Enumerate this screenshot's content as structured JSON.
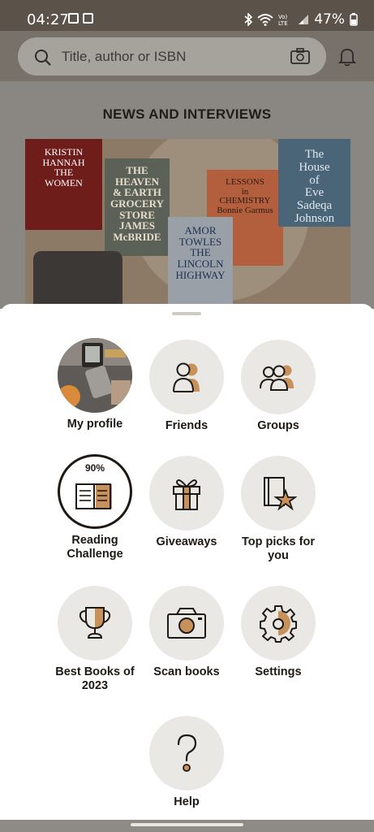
{
  "status_bar": {
    "time": "04:27",
    "battery": "47%",
    "icons": [
      "image-icon",
      "sim-icon",
      "bluetooth-icon",
      "wifi-icon",
      "volte-icon",
      "signal-icon",
      "battery-icon"
    ]
  },
  "search": {
    "placeholder": "Title, author or ISBN",
    "icons": [
      "search-icon",
      "camera-scan-icon",
      "bell-icon"
    ]
  },
  "feed": {
    "section_title": "NEWS AND INTERVIEWS",
    "banner_books": [
      {
        "lines": [
          "KRISTIN",
          "HANNAH",
          "THE",
          "WOMEN"
        ]
      },
      {
        "lines": [
          "THE",
          "HEAVEN",
          "& EARTH",
          "GROCERY",
          "STORE",
          "JAMES",
          "McBRIDE"
        ]
      },
      {
        "lines": [
          "AMOR",
          "TOWLES",
          "THE",
          "LINCOLN",
          "HIGHWAY"
        ]
      },
      {
        "lines": [
          "LESSONS",
          "in",
          "CHEMISTRY",
          "Bonnie Garmus"
        ]
      },
      {
        "lines": [
          "The",
          "House",
          "of",
          "Eve",
          "Sadeqa Johnson"
        ]
      }
    ]
  },
  "menu": {
    "items": [
      {
        "label": "My profile",
        "icon": "profile-photo"
      },
      {
        "label": "Friends",
        "icon": "friends-icon"
      },
      {
        "label": "Groups",
        "icon": "groups-icon"
      },
      {
        "label": "Reading Challenge",
        "progress": "90%",
        "icon": "open-book-icon"
      },
      {
        "label": "Giveaways",
        "icon": "gift-icon"
      },
      {
        "label": "Top picks for you",
        "icon": "book-star-icon"
      },
      {
        "label": "Best Books of 2023",
        "icon": "trophy-icon"
      },
      {
        "label": "Scan books",
        "icon": "camera-icon"
      },
      {
        "label": "Settings",
        "icon": "gear-icon"
      },
      {
        "label": "Help",
        "icon": "question-icon"
      }
    ]
  },
  "colors": {
    "accent": "#c8915a",
    "ink": "#1e1915",
    "tile_bg": "#e9e8e5"
  }
}
